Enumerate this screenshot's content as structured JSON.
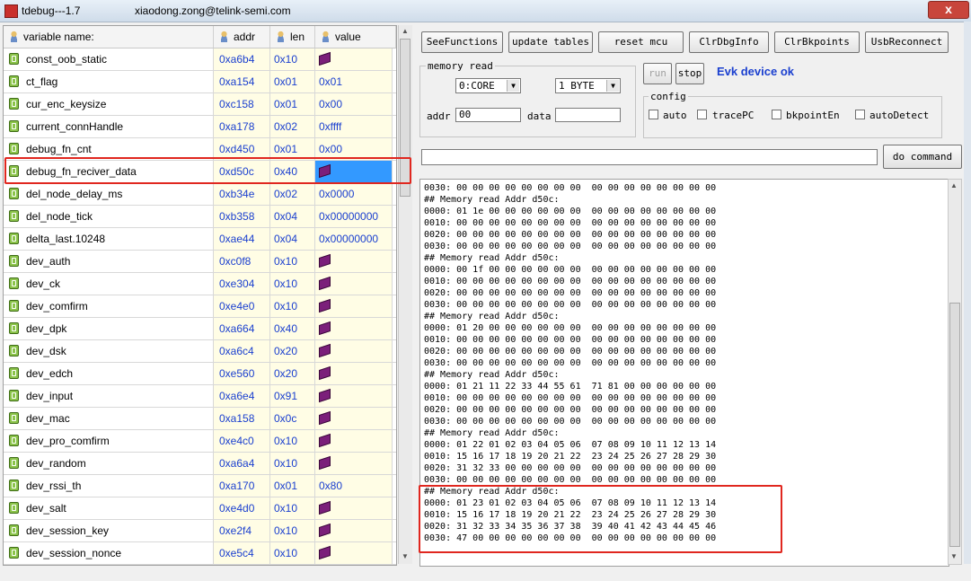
{
  "window": {
    "title": "tdebug---1.7",
    "user": "xiaodong.zong@telink-semi.com",
    "close_label": "x"
  },
  "table": {
    "headers": {
      "name": "variable name:",
      "addr": "addr",
      "len": "len",
      "value": "value"
    },
    "rows": [
      {
        "name": "const_oob_static",
        "addr": "0xa6b4",
        "len": "0x10",
        "value": "",
        "value_icon": "book-icon"
      },
      {
        "name": "ct_flag",
        "addr": "0xa154",
        "len": "0x01",
        "value": "0x01"
      },
      {
        "name": "cur_enc_keysize",
        "addr": "0xc158",
        "len": "0x01",
        "value": "0x00"
      },
      {
        "name": "current_connHandle",
        "addr": "0xa178",
        "len": "0x02",
        "value": "0xffff"
      },
      {
        "name": "debug_fn_cnt",
        "addr": "0xd450",
        "len": "0x01",
        "value": "0x00"
      },
      {
        "name": "debug_fn_reciver_data",
        "addr": "0xd50c",
        "len": "0x40",
        "value": "",
        "value_icon": "book-icon",
        "selected": true
      },
      {
        "name": "del_node_delay_ms",
        "addr": "0xb34e",
        "len": "0x02",
        "value": "0x0000"
      },
      {
        "name": "del_node_tick",
        "addr": "0xb358",
        "len": "0x04",
        "value": "0x00000000"
      },
      {
        "name": "delta_last.10248",
        "addr": "0xae44",
        "len": "0x04",
        "value": "0x00000000"
      },
      {
        "name": "dev_auth",
        "addr": "0xc0f8",
        "len": "0x10",
        "value": "",
        "value_icon": "book-icon"
      },
      {
        "name": "dev_ck",
        "addr": "0xe304",
        "len": "0x10",
        "value": "",
        "value_icon": "book-icon"
      },
      {
        "name": "dev_comfirm",
        "addr": "0xe4e0",
        "len": "0x10",
        "value": "",
        "value_icon": "book-icon"
      },
      {
        "name": "dev_dpk",
        "addr": "0xa664",
        "len": "0x40",
        "value": "",
        "value_icon": "book-icon"
      },
      {
        "name": "dev_dsk",
        "addr": "0xa6c4",
        "len": "0x20",
        "value": "",
        "value_icon": "book-icon"
      },
      {
        "name": "dev_edch",
        "addr": "0xe560",
        "len": "0x20",
        "value": "",
        "value_icon": "book-icon"
      },
      {
        "name": "dev_input",
        "addr": "0xa6e4",
        "len": "0x91",
        "value": "",
        "value_icon": "book-icon"
      },
      {
        "name": "dev_mac",
        "addr": "0xa158",
        "len": "0x0c",
        "value": "",
        "value_icon": "book-icon"
      },
      {
        "name": "dev_pro_comfirm",
        "addr": "0xe4c0",
        "len": "0x10",
        "value": "",
        "value_icon": "book-icon"
      },
      {
        "name": "dev_random",
        "addr": "0xa6a4",
        "len": "0x10",
        "value": "",
        "value_icon": "book-icon"
      },
      {
        "name": "dev_rssi_th",
        "addr": "0xa170",
        "len": "0x01",
        "value": "0x80"
      },
      {
        "name": "dev_salt",
        "addr": "0xe4d0",
        "len": "0x10",
        "value": "",
        "value_icon": "book-icon"
      },
      {
        "name": "dev_session_key",
        "addr": "0xe2f4",
        "len": "0x10",
        "value": "",
        "value_icon": "book-icon"
      },
      {
        "name": "dev_session_nonce",
        "addr": "0xe5c4",
        "len": "0x10",
        "value": "",
        "value_icon": "book-icon"
      }
    ]
  },
  "toolbar": {
    "see_functions": "SeeFunctions",
    "update_tables": "update tables",
    "reset_mcu": "reset mcu",
    "clr_dbg_info": "ClrDbgInfo",
    "clr_bkpoints": "ClrBkpoints",
    "usb_reconnect": "UsbReconnect"
  },
  "memory_read": {
    "title": "memory read",
    "core_select": "0:CORE",
    "size_select": "1 BYTE",
    "addr_label": "addr",
    "addr_value": "00",
    "data_label": "data",
    "data_value": ""
  },
  "run_label": "run",
  "stop_label": "stop",
  "status_text": "Evk device ok",
  "config": {
    "title": "config",
    "auto": "auto",
    "trace_pc": "tracePC",
    "bkpoint_en": "bkpointEn",
    "auto_detect": "autoDetect"
  },
  "command": {
    "value": "",
    "button": "do command"
  },
  "output_lines": [
    "0030: 00 00 00 00 00 00 00 00  00 00 00 00 00 00 00 00",
    "## Memory read Addr d50c:",
    "0000: 01 1e 00 00 00 00 00 00  00 00 00 00 00 00 00 00",
    "0010: 00 00 00 00 00 00 00 00  00 00 00 00 00 00 00 00",
    "0020: 00 00 00 00 00 00 00 00  00 00 00 00 00 00 00 00",
    "0030: 00 00 00 00 00 00 00 00  00 00 00 00 00 00 00 00",
    "## Memory read Addr d50c:",
    "0000: 00 1f 00 00 00 00 00 00  00 00 00 00 00 00 00 00",
    "0010: 00 00 00 00 00 00 00 00  00 00 00 00 00 00 00 00",
    "0020: 00 00 00 00 00 00 00 00  00 00 00 00 00 00 00 00",
    "0030: 00 00 00 00 00 00 00 00  00 00 00 00 00 00 00 00",
    "## Memory read Addr d50c:",
    "0000: 01 20 00 00 00 00 00 00  00 00 00 00 00 00 00 00",
    "0010: 00 00 00 00 00 00 00 00  00 00 00 00 00 00 00 00",
    "0020: 00 00 00 00 00 00 00 00  00 00 00 00 00 00 00 00",
    "0030: 00 00 00 00 00 00 00 00  00 00 00 00 00 00 00 00",
    "## Memory read Addr d50c:",
    "0000: 01 21 11 22 33 44 55 61  71 81 00 00 00 00 00 00",
    "0010: 00 00 00 00 00 00 00 00  00 00 00 00 00 00 00 00",
    "0020: 00 00 00 00 00 00 00 00  00 00 00 00 00 00 00 00",
    "0030: 00 00 00 00 00 00 00 00  00 00 00 00 00 00 00 00",
    "## Memory read Addr d50c:",
    "0000: 01 22 01 02 03 04 05 06  07 08 09 10 11 12 13 14",
    "0010: 15 16 17 18 19 20 21 22  23 24 25 26 27 28 29 30",
    "0020: 31 32 33 00 00 00 00 00  00 00 00 00 00 00 00 00",
    "0030: 00 00 00 00 00 00 00 00  00 00 00 00 00 00 00 00",
    "## Memory read Addr d50c:",
    "0000: 01 23 01 02 03 04 05 06  07 08 09 10 11 12 13 14",
    "0010: 15 16 17 18 19 20 21 22  23 24 25 26 27 28 29 30",
    "0020: 31 32 33 34 35 36 37 38  39 40 41 42 43 44 45 46",
    "0030: 47 00 00 00 00 00 00 00  00 00 00 00 00 00 00 00"
  ]
}
